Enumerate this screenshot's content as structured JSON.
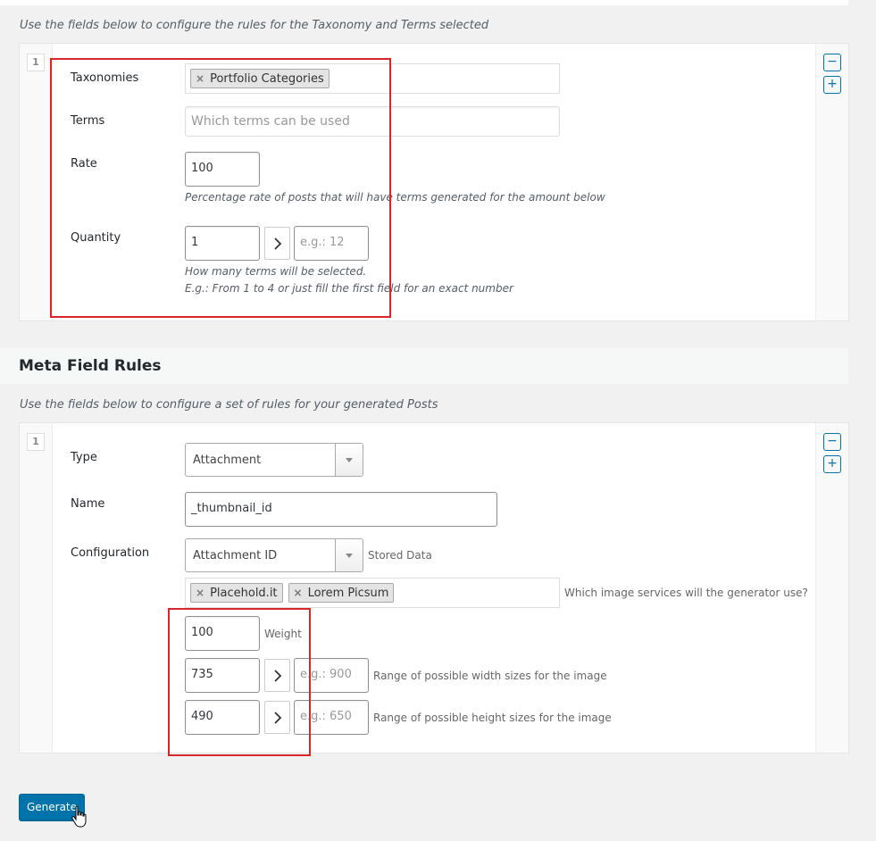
{
  "taxonomy_section": {
    "description": "Use the fields below to configure the rules for the Taxonomy and Terms selected",
    "row_index": "1",
    "remove_label": "−",
    "add_label": "+",
    "fields": {
      "taxonomies_label": "Taxonomies",
      "taxonomies_tags": [
        "Portfolio Categories"
      ],
      "terms_label": "Terms",
      "terms_placeholder": "Which terms can be used",
      "rate_label": "Rate",
      "rate_value": "100",
      "rate_hint": "Percentage rate of posts that will have terms generated for the amount below",
      "quantity_label": "Quantity",
      "quantity_min": "1",
      "quantity_max_placeholder": "e.g.: 12",
      "quantity_hint_1": "How many terms will be selected.",
      "quantity_hint_2": "E.g.: From 1 to 4 or just fill the first field for an exact number"
    }
  },
  "meta_section": {
    "title": "Meta Field Rules",
    "description": "Use the fields below to configure a set of rules for your generated Posts",
    "row_index": "1",
    "remove_label": "−",
    "add_label": "+",
    "fields": {
      "type_label": "Type",
      "type_value": "Attachment",
      "name_label": "Name",
      "name_value": "_thumbnail_id",
      "config_label": "Configuration",
      "config_value": "Attachment ID",
      "config_hint": "Stored Data",
      "services_tags": [
        "Placehold.it",
        "Lorem Picsum"
      ],
      "services_hint": "Which image services will the generator use?",
      "weight_value": "100",
      "weight_hint": "Weight",
      "width_min": "735",
      "width_max_placeholder": "e.g.: 900",
      "width_hint": "Range of possible width sizes for the image",
      "height_min": "490",
      "height_max_placeholder": "e.g.: 650",
      "height_hint": "Range of possible height sizes for the image"
    }
  },
  "generate_button": "Generate",
  "colors": {
    "accent": "#0073aa",
    "highlight_border": "#d9262a"
  },
  "tag_remove_icon": "×",
  "chevron_icon": "chevron-right-icon"
}
